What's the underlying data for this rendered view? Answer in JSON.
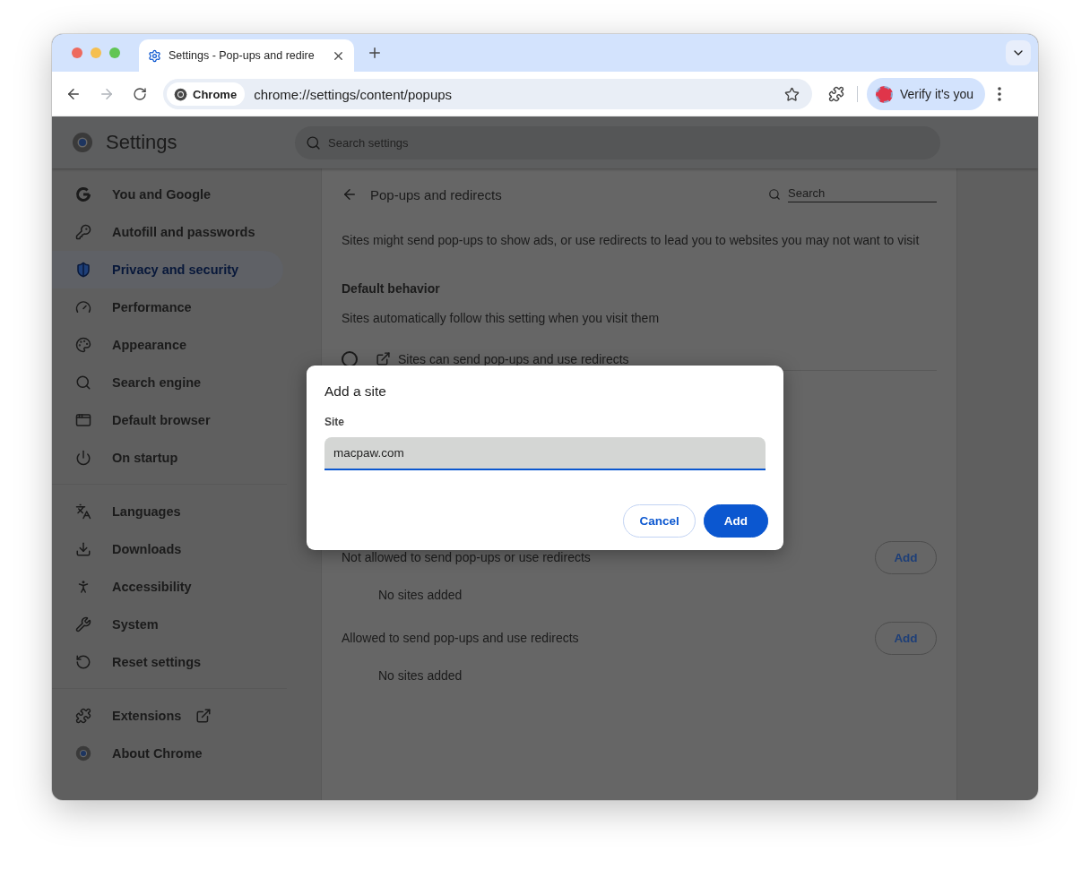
{
  "tab": {
    "title": "Settings - Pop-ups and redire"
  },
  "toolbar": {
    "forward_disabled": true,
    "chip": "Chrome",
    "address": "chrome://settings/content/popups",
    "profile": "Verify it's you"
  },
  "settings": {
    "title": "Settings",
    "search_placeholder": "Search settings"
  },
  "nav_groups": [
    [
      {
        "label": "You and Google",
        "selected": false,
        "external_link": false
      },
      {
        "label": "Autofill and passwords",
        "selected": false,
        "external_link": false
      },
      {
        "label": "Privacy and security",
        "selected": true,
        "external_link": false
      },
      {
        "label": "Performance",
        "selected": false,
        "external_link": false
      },
      {
        "label": "Appearance",
        "selected": false,
        "external_link": false
      },
      {
        "label": "Search engine",
        "selected": false,
        "external_link": false
      },
      {
        "label": "Default browser",
        "selected": false,
        "external_link": false
      },
      {
        "label": "On startup",
        "selected": false,
        "external_link": false
      }
    ],
    [
      {
        "label": "Languages",
        "selected": false,
        "external_link": false
      },
      {
        "label": "Downloads",
        "selected": false,
        "external_link": false
      },
      {
        "label": "Accessibility",
        "selected": false,
        "external_link": false
      },
      {
        "label": "System",
        "selected": false,
        "external_link": false
      },
      {
        "label": "Reset settings",
        "selected": false,
        "external_link": false
      }
    ],
    [
      {
        "label": "Extensions",
        "selected": false,
        "external_link": true
      },
      {
        "label": "About Chrome",
        "selected": false,
        "external_link": false
      }
    ]
  ],
  "page": {
    "title": "Pop-ups and redirects",
    "search_placeholder": "Search",
    "description": "Sites might send pop-ups to show ads, or use redirects to lead you to websites you may not want to visit",
    "default_heading": "Default behavior",
    "default_sub": "Sites automatically follow this setting when you visit them",
    "options": [
      {
        "label": "Sites can send pop-ups and use redirects",
        "selected": false
      }
    ],
    "lists": [
      {
        "title": "Not allowed to send pop-ups or use redirects",
        "button": "Add",
        "empty": "No sites added"
      },
      {
        "title": "Allowed to send pop-ups and use redirects",
        "button": "Add",
        "empty": "No sites added"
      }
    ]
  },
  "dialog": {
    "title": "Add a site",
    "field_label": "Site",
    "value": "macpaw.com",
    "buttons": [
      {
        "label": "Cancel",
        "primary": false
      },
      {
        "label": "Add",
        "primary": true
      }
    ]
  }
}
